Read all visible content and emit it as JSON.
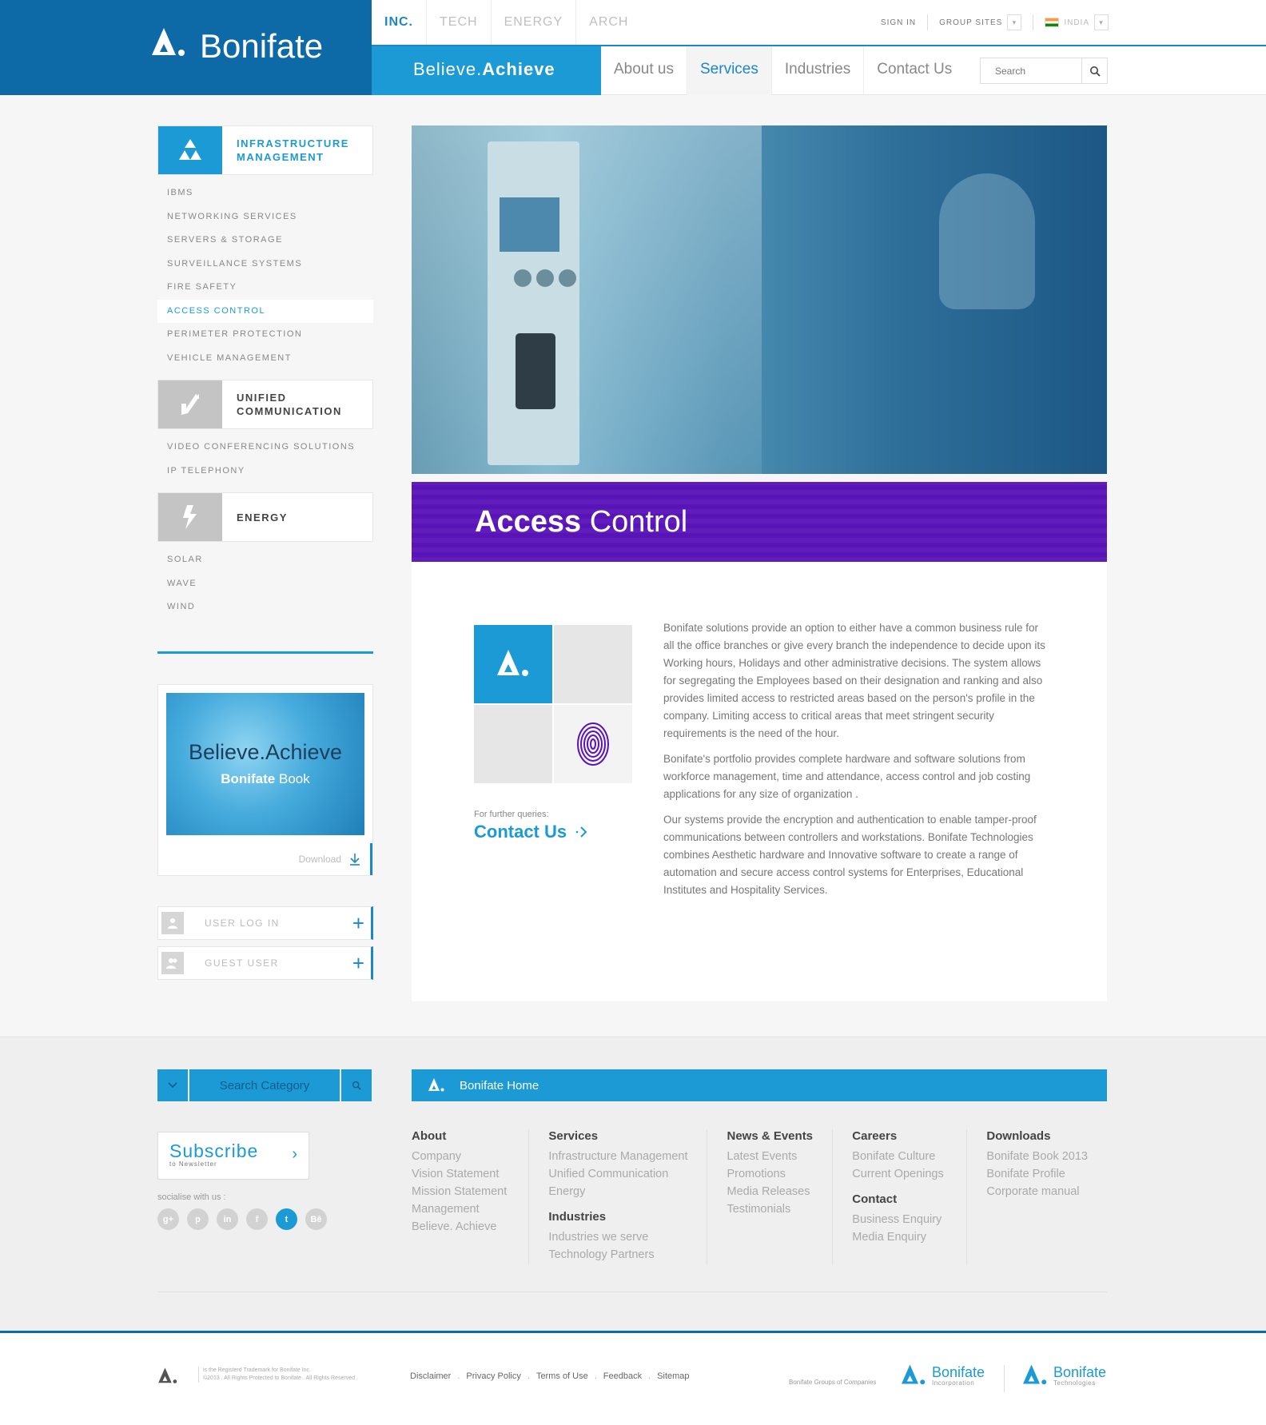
{
  "brand": {
    "name": "Bonifate"
  },
  "top_tabs": [
    "INC.",
    "TECH",
    "ENERGY",
    "ARCH"
  ],
  "top_right": {
    "sign_in": "SIGN IN",
    "group_sites": "GROUP SITES",
    "country": "INDIA"
  },
  "slogan": {
    "part1": "Believe.",
    "part2": "Achieve"
  },
  "nav": {
    "items": [
      "About us",
      "Services",
      "Industries",
      "Contact Us"
    ],
    "active": "Services"
  },
  "search": {
    "placeholder": "Search"
  },
  "sidebar": {
    "categories": [
      {
        "title_line1": "INFRASTRUCTURE",
        "title_line2": "MANAGEMENT",
        "active": true,
        "items": [
          "IBMS",
          "NETWORKING SERVICES",
          "SERVERS & STORAGE",
          "SURVEILLANCE SYSTEMS",
          "FIRE SAFETY",
          "ACCESS CONTROL",
          "PERIMETER PROTECTION",
          "VEHICLE MANAGEMENT"
        ]
      },
      {
        "title_line1": "UNIFIED",
        "title_line2": "COMMUNICATION",
        "active": false,
        "items": [
          "VIDEO CONFERENCING SOLUTIONS",
          "IP TELEPHONY"
        ]
      },
      {
        "title_line1": "ENERGY",
        "title_line2": "",
        "active": false,
        "items": [
          "SOLAR",
          "WAVE",
          "WIND"
        ]
      }
    ],
    "active_item": "ACCESS CONTROL",
    "book": {
      "title1": "Believe.",
      "title2": "Achieve",
      "sub_bold": "Bonifate",
      "sub_rest": "Book",
      "download": "Download"
    },
    "user_login": "USER LOG IN",
    "guest_user": "GUEST USER"
  },
  "main": {
    "title_bold": "Access",
    "title_rest": "Control",
    "further": "For further queries:",
    "contact": "Contact Us",
    "paragraphs": [
      "Bonifate solutions provide an option to either have a common business rule for all the office branches or give every branch the independence to decide upon its Working hours, Holidays and other administrative decisions. The system allows for segregating the Employees based on their designation and ranking and also provides limited access to restricted areas based on the person's profile in the company. Limiting access to critical areas that meet stringent security requirements is the need of the hour.",
      "Bonifate's portfolio provides complete hardware and software solutions from workforce management, time and attendance, access control and job costing applications for any size of organization .",
      "Our systems provide the encryption and authentication to enable tamper-proof communications between controllers and workstations. Bonifate Technologies combines Aesthetic hardware and Innovative software to create a range of automation and secure access control systems for Enterprises, Educational Institutes and Hospitality Services."
    ]
  },
  "footer": {
    "search_category": "Search Category",
    "home": "Bonifate Home",
    "subscribe": "Subscribe",
    "subscribe_sub": "to Newsletter",
    "socialise": "socialise with us :",
    "social": [
      "g+",
      "p",
      "in",
      "f",
      "t",
      "Bē"
    ],
    "columns": [
      {
        "sections": [
          {
            "head": "About",
            "links": [
              "Company",
              "Vision Statement",
              "Mission Statement",
              "Management",
              "Believe. Achieve"
            ]
          }
        ]
      },
      {
        "sections": [
          {
            "head": "Services",
            "links": [
              "Infrastructure Management",
              "Unified Communication",
              "Energy"
            ]
          },
          {
            "head": "Industries",
            "links": [
              "Industries we serve",
              "Technology Partners"
            ]
          }
        ]
      },
      {
        "sections": [
          {
            "head": "News & Events",
            "links": [
              "Latest Events",
              "Promotions",
              "Media Releases",
              "Testimonials"
            ]
          }
        ]
      },
      {
        "sections": [
          {
            "head": "Careers",
            "links": [
              "Bonifate Culture",
              "Current Openings"
            ]
          },
          {
            "head": "Contact",
            "links": [
              "Business Enquiry",
              "Media Enquiry"
            ]
          }
        ]
      },
      {
        "sections": [
          {
            "head": "Downloads",
            "links": [
              "Bonifate Book 2013",
              "Bonifate Profile",
              "Corporate manual"
            ]
          }
        ]
      }
    ],
    "legal_line1": "is the Registerd Trademark for Bonifate Inc.",
    "legal_line2": "©2013 . All Rights Protected to Bonifate . All Rights Reserved .",
    "bottom_links": [
      "Disclaimer",
      "Privacy Policy",
      "Terms of Use",
      "Feedback",
      "Sitemap"
    ],
    "group_label": "Bonifate Groups of Companies",
    "companies": [
      {
        "name": "Bonifate",
        "sub": "Incorporation"
      },
      {
        "name": "Bonifate",
        "sub": "Technologies"
      }
    ]
  },
  "colors": {
    "primary": "#1b9ad6",
    "dark_blue": "#0d6aa6",
    "banner_purple": "#5914b8"
  }
}
